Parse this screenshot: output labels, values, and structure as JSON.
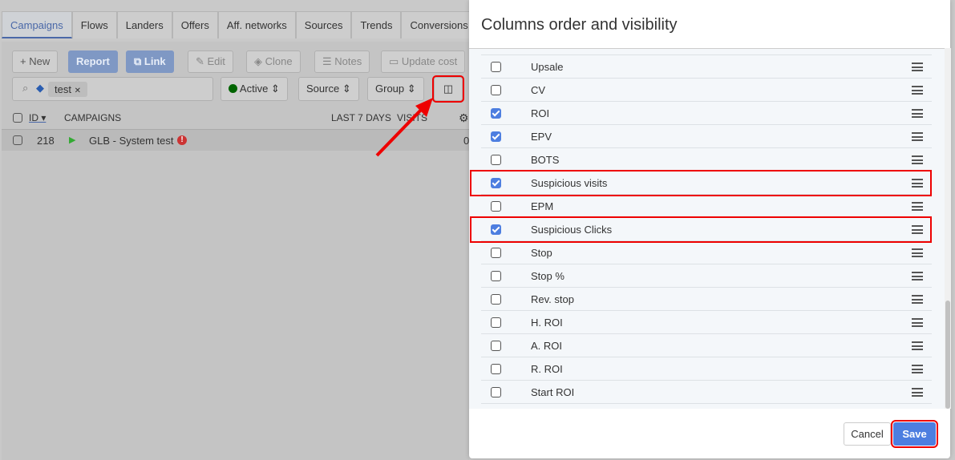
{
  "tabs": [
    "Campaigns",
    "Flows",
    "Landers",
    "Offers",
    "Aff. networks",
    "Sources",
    "Trends",
    "Conversions"
  ],
  "toolbar": {
    "new": "New",
    "report": "Report",
    "link": "Link",
    "edit": "Edit",
    "clone": "Clone",
    "notes": "Notes",
    "update_cost": "Update cost"
  },
  "filters": {
    "tag": "test",
    "status": "Active",
    "source": "Source",
    "group": "Group"
  },
  "table": {
    "headers": {
      "id": "ID",
      "campaigns": "CAMPAIGNS",
      "last7": "LAST 7 DAYS",
      "visits": "VISITS"
    },
    "rows": [
      {
        "id": "218",
        "name": "GLB - System test",
        "visits": "0"
      }
    ]
  },
  "modal": {
    "title": "Columns order and visibility",
    "cancel": "Cancel",
    "save": "Save",
    "items": [
      {
        "label": "Upsale",
        "checked": false
      },
      {
        "label": "CV",
        "checked": false
      },
      {
        "label": "ROI",
        "checked": true
      },
      {
        "label": "EPV",
        "checked": true
      },
      {
        "label": "BOTS",
        "checked": false
      },
      {
        "label": "Suspicious visits",
        "checked": true,
        "highlighted": true
      },
      {
        "label": "EPM",
        "checked": false
      },
      {
        "label": "Suspicious Clicks",
        "checked": true,
        "highlighted": true
      },
      {
        "label": "Stop",
        "checked": false
      },
      {
        "label": "Stop %",
        "checked": false
      },
      {
        "label": "Rev. stop",
        "checked": false
      },
      {
        "label": "H. ROI",
        "checked": false
      },
      {
        "label": "A. ROI",
        "checked": false
      },
      {
        "label": "R. ROI",
        "checked": false
      },
      {
        "label": "Start ROI",
        "checked": false
      }
    ]
  },
  "colors": {
    "accent": "#4d7ee0",
    "highlight": "#e00000",
    "active_status": "#006400"
  }
}
